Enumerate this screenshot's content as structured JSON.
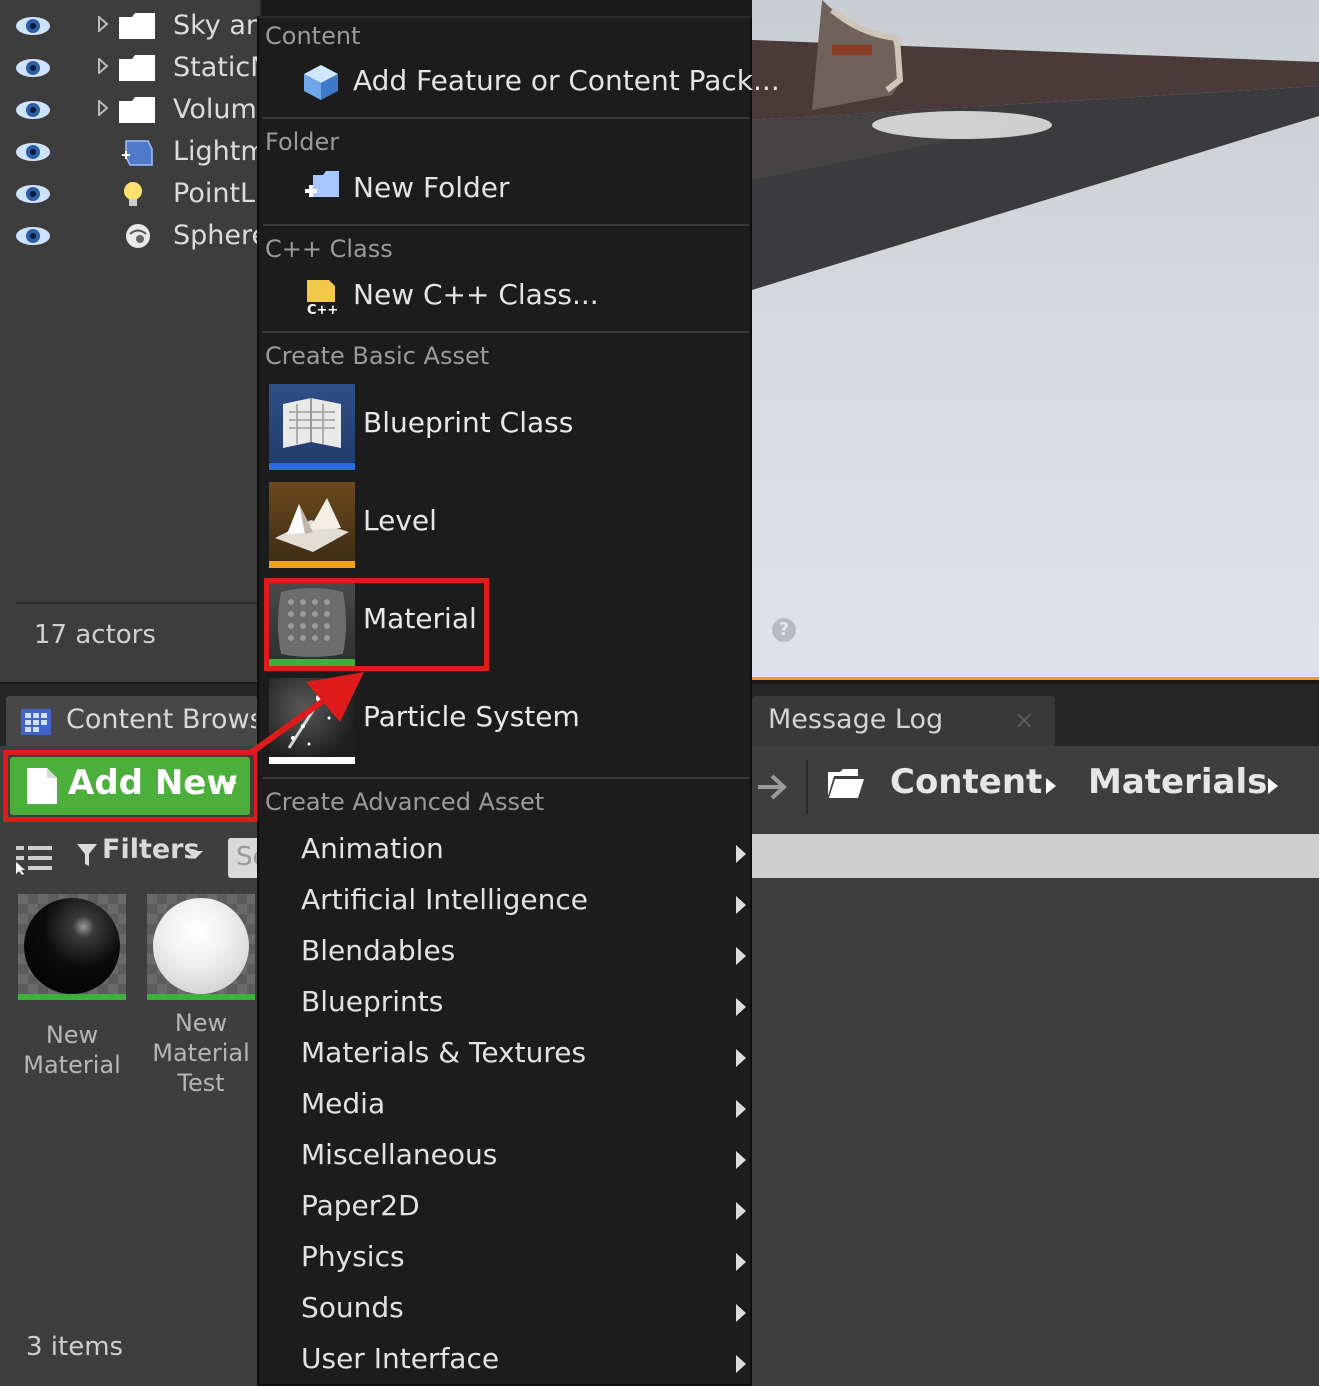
{
  "outliner": {
    "rows": [
      {
        "label": "Sky and Fog",
        "type_icon": "folder-icon"
      },
      {
        "label": "StaticMeshes",
        "type_icon": "folder-icon"
      },
      {
        "label": "Volumes",
        "type_icon": "folder-icon"
      },
      {
        "label": "Lightmass",
        "type_icon": "lightmass-volume-icon"
      },
      {
        "label": "PointLight",
        "type_icon": "point-light-icon"
      },
      {
        "label": "SphereReflection",
        "type_icon": "sphere-reflection-icon"
      }
    ],
    "actors_count": "17 actors"
  },
  "tabs": {
    "content_browser": "Content Browser",
    "message_log": "Message Log",
    "message_log_close": "×"
  },
  "toolbar": {
    "add_new_label": "Add New",
    "filters_label": "Filters",
    "search_placeholder": "Search"
  },
  "breadcrumb": {
    "items": [
      "Content",
      "Materials"
    ]
  },
  "assets": [
    {
      "name": "New Material",
      "sphere_color": "#111111"
    },
    {
      "name": "New Material Test",
      "sphere_color": "#f2f2f2"
    }
  ],
  "items_count": "3 items",
  "menu": {
    "sections": {
      "content": "Content",
      "folder": "Folder",
      "cpp": "C++ Class",
      "basic": "Create Basic Asset",
      "advanced": "Create Advanced Asset"
    },
    "add_feature": "Add Feature or Content Pack...",
    "new_folder": "New Folder",
    "new_cpp": "New C++ Class...",
    "basic_assets": [
      {
        "label": "Blueprint Class",
        "bar_color": "#2e6fd6"
      },
      {
        "label": "Level",
        "bar_color": "#f0a21c"
      },
      {
        "label": "Material",
        "bar_color": "#3bb33b"
      },
      {
        "label": "Particle System",
        "bar_color": "#ffffff"
      }
    ],
    "advanced_assets": [
      "Animation",
      "Artificial Intelligence",
      "Blendables",
      "Blueprints",
      "Materials & Textures",
      "Media",
      "Miscellaneous",
      "Paper2D",
      "Physics",
      "Sounds",
      "User Interface"
    ]
  },
  "colors": {
    "add_new_green": "#4caf3c",
    "highlight_red": "#e01b1b",
    "viewport_border": "#e49e2d"
  }
}
